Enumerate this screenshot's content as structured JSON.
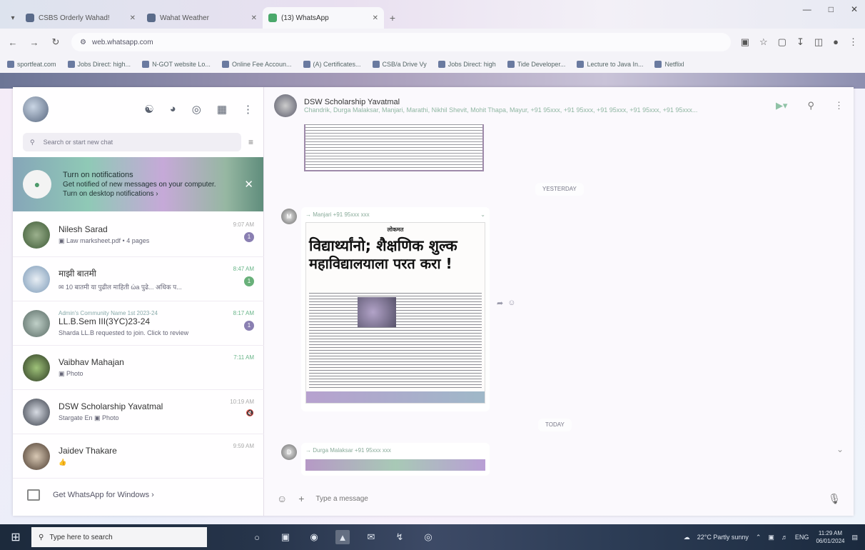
{
  "browser": {
    "tabs": [
      {
        "title": "CSBS Orderly Wahad!",
        "active": false
      },
      {
        "title": "Wahat Weather",
        "active": false
      },
      {
        "title": "(13) WhatsApp",
        "active": true
      }
    ],
    "url": "web.whatsapp.com",
    "bookmarks": [
      "sportfeat.com",
      "Jobs Direct: high...",
      "N-GOT website Lo...",
      "Online Fee Accoun...",
      "(A) Certificates...",
      "CSB/a Drive Vy",
      "Jobs Direct: high",
      "Tide Developer...",
      "Lecture to Java In...",
      "Netflixl"
    ]
  },
  "sidebar": {
    "search_placeholder": "Search or start new chat",
    "notification": {
      "title": "Turn on notifications",
      "line1": "Get notified of new messages on your computer.",
      "line2": "Turn on desktop notifications ›"
    },
    "chats": [
      {
        "name": "Nilesh Sarad",
        "sub": "",
        "preview": "▣ Law marksheet.pdf • 4 pages",
        "time": "9:07 AM",
        "badge": "1",
        "badge_color": "purple",
        "time_color": "grey",
        "muted": false
      },
      {
        "name": "माझी बातमी",
        "sub": "",
        "preview": "✉ 10 बातमी या पुढील माहिती ὠa पुढे... अधिक प...",
        "time": "8:47 AM",
        "badge": "1",
        "badge_color": "green",
        "time_color": "green",
        "muted": false
      },
      {
        "name": "LL.B.Sem III(3YC)23-24",
        "sub": "Admin's Community Name 1st 2023-24",
        "preview": "Sharda LL.B requested to join. Click to review",
        "time": "8:17 AM",
        "badge": "1",
        "badge_color": "purple",
        "time_color": "green",
        "muted": false
      },
      {
        "name": "Vaibhav Mahajan",
        "sub": "",
        "preview": "▣ Photo",
        "time": "7:11 AM",
        "badge": "",
        "badge_color": "",
        "time_color": "green",
        "muted": false
      },
      {
        "name": "DSW Scholarship Yavatmal",
        "sub": "",
        "preview": "Stargate En ▣ Photo",
        "time": "10:19 AM",
        "badge": "",
        "badge_color": "",
        "time_color": "grey",
        "muted": true
      },
      {
        "name": "Jaidev Thakare",
        "sub": "",
        "preview": "👍",
        "time": "9:59 AM",
        "badge": "",
        "badge_color": "",
        "time_color": "grey",
        "muted": false
      }
    ],
    "get_windows": "Get WhatsApp for Windows ›"
  },
  "conversation": {
    "title": "DSW Scholarship Yavatmal",
    "members": "Chandrik, Durga Malaksar, Manjari, Marathi, Nikhil Shevit, Mohit Thapa, Mayur, +91 95xxx, +91 95xxx, +91 95xxx, +91 95xxx, +91 95xxx...",
    "date1": "YESTERDAY",
    "date2": "TODAY",
    "msg1_sender": "→ Manjari  +91 95xxx xxx",
    "news_mast": "लोकमत",
    "news_hl1": "विद्यार्थ्यांनो; शैक्षणिक शुल्क",
    "news_hl2": "महाविद्यालयाला परत करा !",
    "msg2_sender": "→ Durga Malaksar  +91 95xxx xxx",
    "compose_placeholder": "Type a message"
  },
  "taskbar": {
    "search_placeholder": "Type here to search",
    "weather": "22°C  Partly sunny",
    "lang": "ENG",
    "time": "11:29 AM",
    "date": "06/01/2024"
  },
  "colors": {
    "accent": "#69b07a",
    "badge": "#8a7fb2"
  }
}
